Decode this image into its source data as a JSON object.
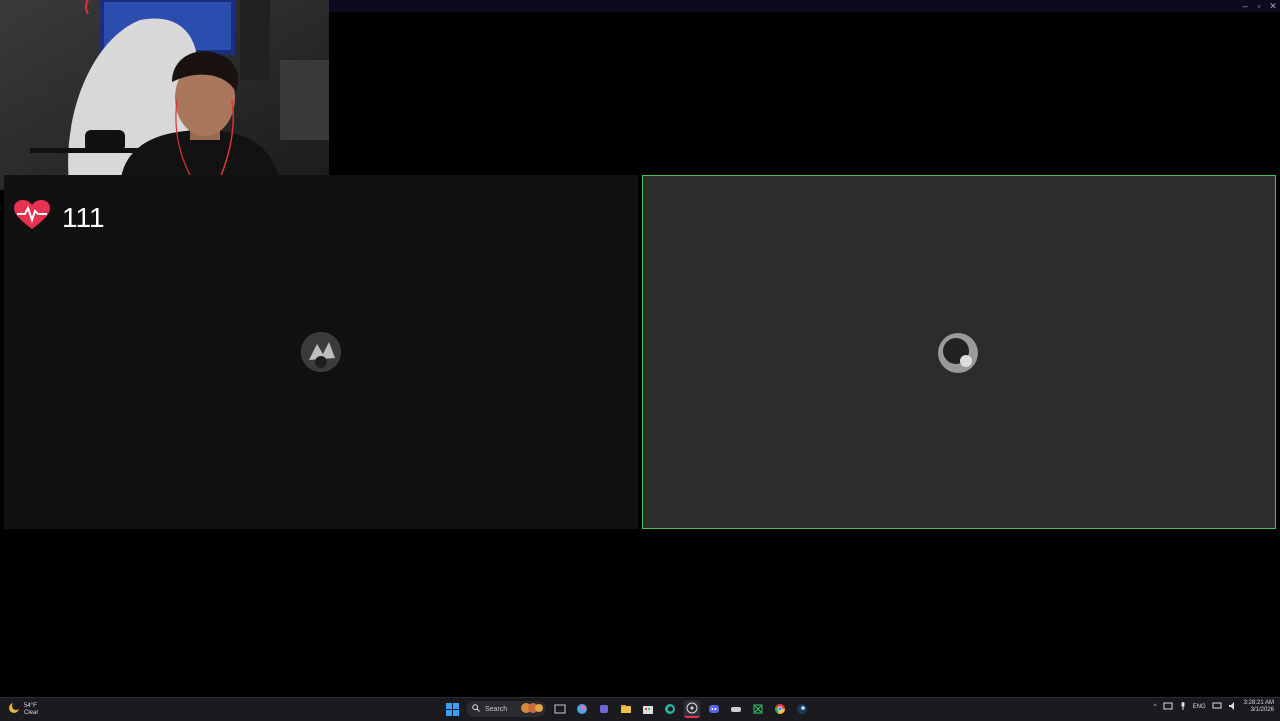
{
  "window": {
    "minimize_icon": "minimize-icon",
    "maximize_icon": "maximize-icon",
    "close_icon": "close-icon"
  },
  "overlay": {
    "heart_rate": "111",
    "heart_icon": "heart-pulse-icon",
    "heart_color": "#e8304f"
  },
  "call": {
    "active_border_color": "#4bbd5a"
  },
  "taskbar": {
    "weather": {
      "temp": "54°F",
      "condition": "Clear"
    },
    "search_label": "Search",
    "tray": {
      "language": "ENG",
      "time": "3:28:21 AM",
      "date": "3/1/2026"
    }
  }
}
